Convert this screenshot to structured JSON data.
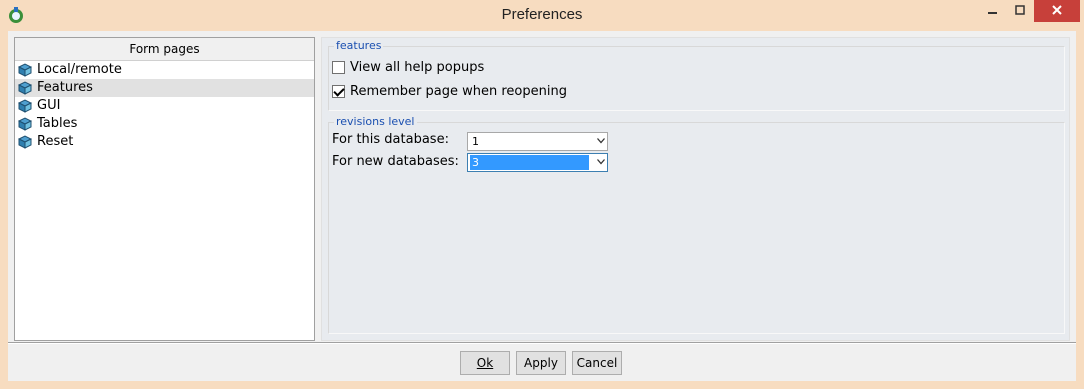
{
  "window": {
    "title": "Preferences",
    "title_icon": "app-icon"
  },
  "colors": {
    "frame": "#f7dcc0",
    "close_button": "#c7403a",
    "group_label": "#1a4fb0",
    "selection": "#3399ff"
  },
  "sidebar": {
    "header": "Form pages",
    "items": [
      {
        "label": "Local/remote",
        "icon": "book-icon",
        "selected": false
      },
      {
        "label": "Features",
        "icon": "book-icon",
        "selected": true
      },
      {
        "label": "GUI",
        "icon": "book-icon",
        "selected": false
      },
      {
        "label": "Tables",
        "icon": "book-icon",
        "selected": false
      },
      {
        "label": "Reset",
        "icon": "book-icon",
        "selected": false
      }
    ]
  },
  "features": {
    "group_label": "features",
    "view_help_label": "View all help popups",
    "view_help_checked": false,
    "remember_page_label": "Remember page when reopening",
    "remember_page_checked": true
  },
  "revisions": {
    "group_label": "revisions level",
    "this_db_label": "For this database:",
    "this_db_value": "1",
    "new_db_label": "For new databases:",
    "new_db_value": "3"
  },
  "buttons": {
    "ok": "Ok",
    "apply": "Apply",
    "cancel": "Cancel"
  }
}
